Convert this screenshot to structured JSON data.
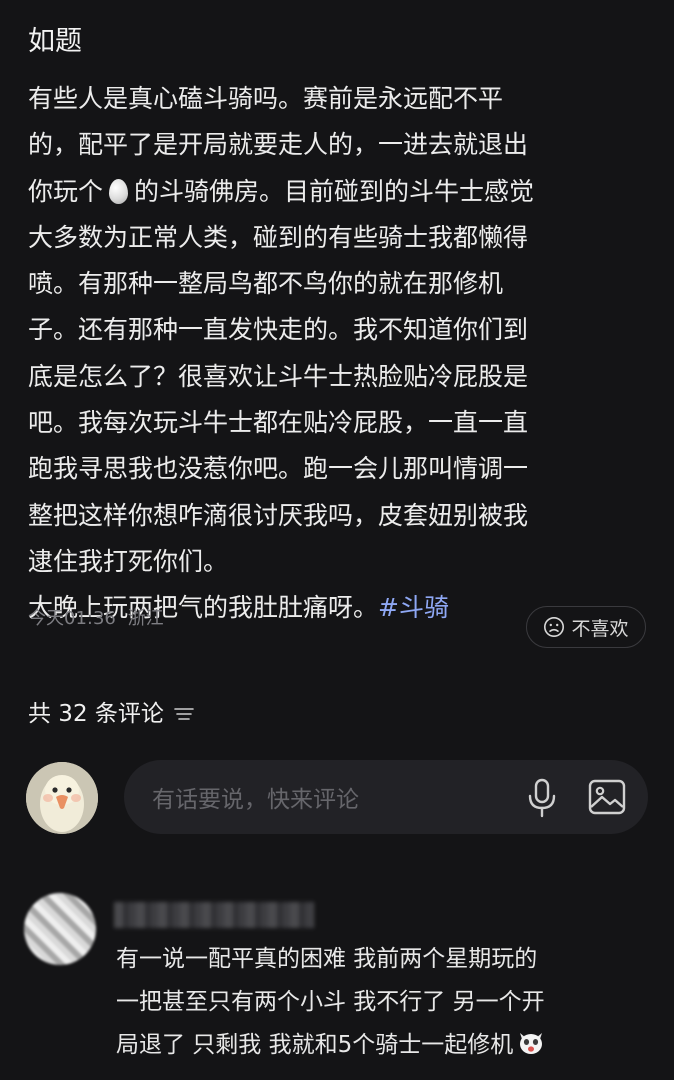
{
  "post": {
    "title": "如题",
    "body_lines": {
      "l1": "有些人是真心磕斗骑吗。赛前是永远配不平",
      "l2": "的，配平了是开局就要走人的，一进去就退出",
      "l3a": "你玩个",
      "l3b": "的斗骑佛房。目前碰到的斗牛士感觉",
      "l4": "大多数为正常人类，碰到的有些骑士我都懒得",
      "l5": "喷。有那种一整局鸟都不鸟你的就在那修机",
      "l6": "子。还有那种一直发快走的。我不知道你们到",
      "l7": "底是怎么了？很喜欢让斗牛士热脸贴冷屁股是",
      "l8": "吧。我每次玩斗牛士都在贴冷屁股，一直一直",
      "l9": "跑我寻思我也没惹你吧。跑一会儿那叫情调一",
      "l10": "整把这样你想咋滴很讨厌我吗，皮套妞别被我",
      "l11": "逮住我打死你们。",
      "l12": "大晚上玩两把气的我肚肚痛呀。"
    },
    "hashtag": "#斗骑",
    "time": "今天01:36",
    "location": "浙江",
    "dislike_label": "不喜欢"
  },
  "comments": {
    "count_label": "共 32 条评论",
    "input_placeholder": "有话要说，快来评论",
    "first": {
      "lines": {
        "l1": "有一说一配平真的困难 我前两个星期玩的",
        "l2": "一把甚至只有两个小斗 我不行了 另一个开",
        "l3": "局退了 只剩我 我就和5个骑士一起修机"
      }
    }
  },
  "icons": {
    "egg": "egg-emoji",
    "dislike": "frown-face-icon",
    "sort": "sort-lines-icon",
    "mic": "microphone-icon",
    "image": "image-icon",
    "comment_emoji": "dog-face-emoji"
  },
  "colors": {
    "background": "#141416",
    "text": "#ececec",
    "meta": "#7d7d82",
    "hashtag": "#8fa8f4",
    "input_bg": "#222226"
  }
}
